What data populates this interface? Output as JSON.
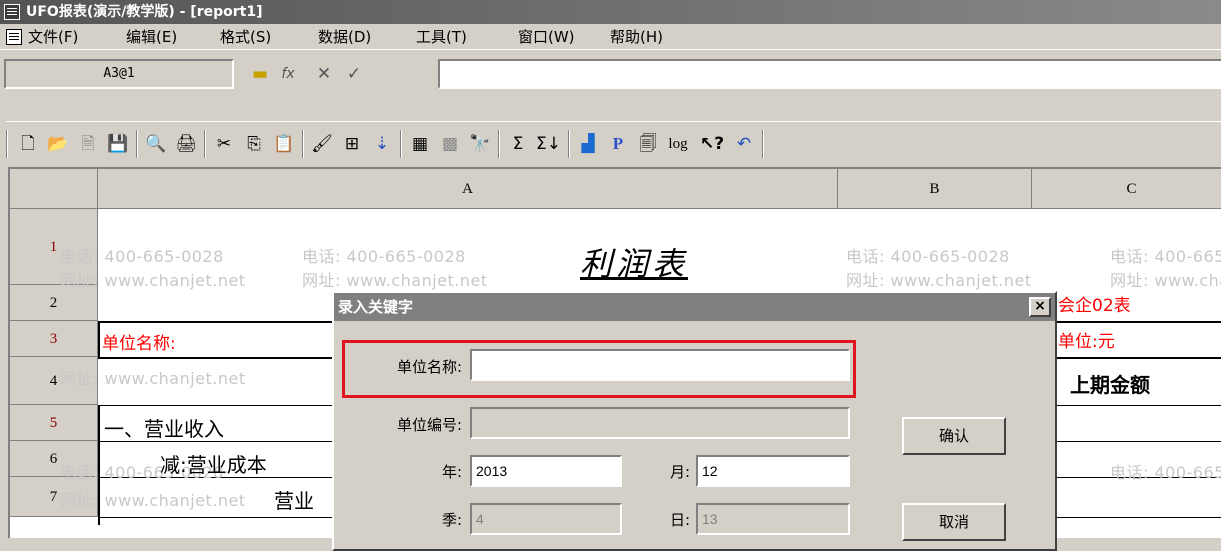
{
  "window": {
    "title": "UFO报表(演示/教学版) - [report1]"
  },
  "menu": [
    {
      "label": "文件(F)"
    },
    {
      "label": "编辑(E)"
    },
    {
      "label": "格式(S)"
    },
    {
      "label": "数据(D)"
    },
    {
      "label": "工具(T)"
    },
    {
      "label": "窗口(W)"
    },
    {
      "label": "帮助(H)"
    }
  ],
  "formula": {
    "cell_ref": "A3@1",
    "fx": "fx",
    "cancel": "✕",
    "confirm": "✓",
    "value": ""
  },
  "toolbar_icons": [
    "new-icon",
    "open-icon",
    "blank-icon",
    "save-icon",
    "preview-icon",
    "print-icon",
    "cut-icon",
    "copy-icon",
    "paste-icon",
    "format-painter-icon",
    "insert-col-icon",
    "sort-icon",
    "grid-icon",
    "pattern-icon",
    "find-icon",
    "sum-icon",
    "sum-list-icon",
    "chart-icon",
    "p-icon",
    "report-icon",
    "log-icon",
    "help-pointer-icon",
    "undo-icon"
  ],
  "toolbar_text": {
    "p": "P",
    "log": "log",
    "help": "?"
  },
  "sheet": {
    "columns": [
      "A",
      "B",
      "C"
    ],
    "rows": [
      "1",
      "2",
      "3",
      "4",
      "5",
      "6",
      "7"
    ],
    "report_title": "利润表",
    "right_note_1": "会企02表",
    "right_note_2": "单位:元",
    "header_right": "上期金额",
    "unit_name_label": "单位名称:",
    "row5": "一、营业收入",
    "row6": "减:营业成本",
    "row7": "营业"
  },
  "watermark": {
    "phone": "电话: 400-665-0028",
    "site": "网址: www.chanjet.net"
  },
  "dialog": {
    "title": "录入关键字",
    "close": "×",
    "fields": {
      "unit_name": {
        "label": "单位名称:",
        "value": ""
      },
      "unit_code": {
        "label": "单位编号:",
        "value": ""
      },
      "year": {
        "label": "年:",
        "value": "2013"
      },
      "month": {
        "label": "月:",
        "value": "12"
      },
      "quarter": {
        "label": "季:",
        "value": "4"
      },
      "day": {
        "label": "日:",
        "value": "13"
      }
    },
    "ok": "确认",
    "cancel": "取消"
  },
  "colors": {
    "highlight": "#e0141e",
    "red_text": "#ff0000"
  }
}
